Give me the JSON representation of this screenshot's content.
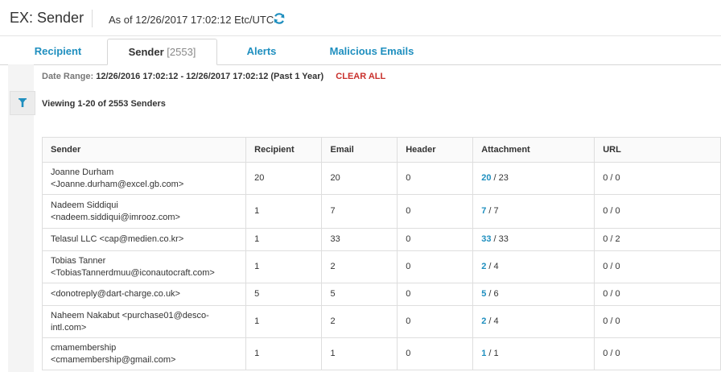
{
  "header": {
    "title": "EX: Sender",
    "as_of": "As of 12/26/2017 17:02:12 Etc/UTC",
    "refresh_icon": "refresh-icon",
    "accent_color": "#1f8fbf"
  },
  "tabs": [
    {
      "label": "Recipient",
      "count": ""
    },
    {
      "label": "Sender",
      "count": "[2553]"
    },
    {
      "label": "Alerts",
      "count": ""
    },
    {
      "label": "Malicious Emails",
      "count": ""
    }
  ],
  "active_tab": "Sender",
  "filter": {
    "date_range_label": "Date Range:",
    "date_range_value": "12/26/2016 17:02:12 - 12/26/2017 17:02:12 (Past 1 Year)",
    "clear_all": "CLEAR ALL",
    "filter_icon": "filter-icon"
  },
  "viewing": "Viewing 1-20 of 2553 Senders",
  "table": {
    "columns": [
      "Sender",
      "Recipient",
      "Email",
      "Header",
      "Attachment",
      "URL"
    ],
    "rows": [
      {
        "sender_line1": "Joanne Durham",
        "sender_line2": "<Joanne.durham@excel.gb.com>",
        "recipient": "20",
        "email": "20",
        "header": "0",
        "attachment_link": "20",
        "attachment_total": " / 23",
        "url": "0 / 0"
      },
      {
        "sender_line1": "Nadeem Siddiqui",
        "sender_line2": "<nadeem.siddiqui@imrooz.com>",
        "recipient": "1",
        "email": "7",
        "header": "0",
        "attachment_link": "7",
        "attachment_total": " / 7",
        "url": "0 / 0"
      },
      {
        "sender_line1": "Telasul LLC <cap@medien.co.kr>",
        "sender_line2": "",
        "recipient": "1",
        "email": "33",
        "header": "0",
        "attachment_link": "33",
        "attachment_total": " / 33",
        "url": "0 / 2"
      },
      {
        "sender_line1": "Tobias Tanner",
        "sender_line2": "<TobiasTannerdmuu@iconautocraft.com>",
        "recipient": "1",
        "email": "2",
        "header": "0",
        "attachment_link": "2",
        "attachment_total": " / 4",
        "url": "0 / 0"
      },
      {
        "sender_line1": "<donotreply@dart-charge.co.uk>",
        "sender_line2": "",
        "recipient": "5",
        "email": "5",
        "header": "0",
        "attachment_link": "5",
        "attachment_total": " / 6",
        "url": "0 / 0"
      },
      {
        "sender_line1": "Naheem Nakabut <purchase01@desco-",
        "sender_line2": "intl.com>",
        "recipient": "1",
        "email": "2",
        "header": "0",
        "attachment_link": "2",
        "attachment_total": " / 4",
        "url": "0 / 0"
      },
      {
        "sender_line1": "cmamembership",
        "sender_line2": "<cmamembership@gmail.com>",
        "recipient": "1",
        "email": "1",
        "header": "0",
        "attachment_link": "1",
        "attachment_total": " / 1",
        "url": "0 / 0"
      }
    ]
  }
}
